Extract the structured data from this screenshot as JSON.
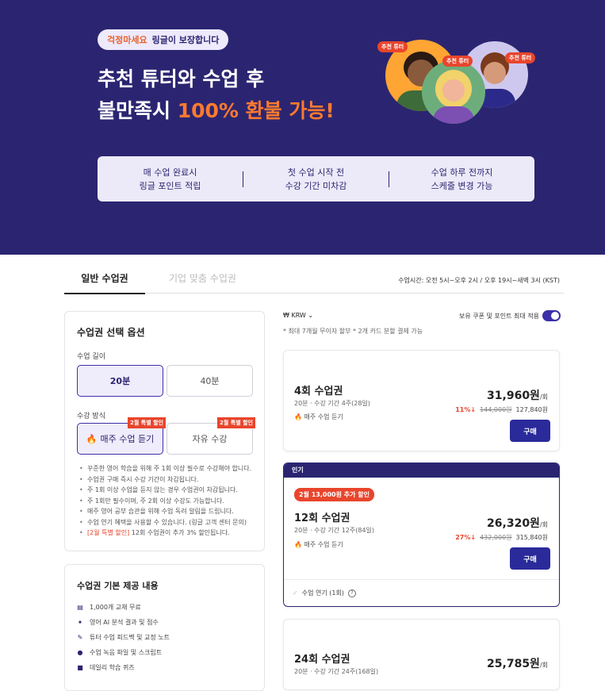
{
  "hero": {
    "pill_highlight": "걱정마세요",
    "pill_text": "링글이 보장합니다",
    "title_line1": "추천 튜터와 수업 후",
    "title_line2_a": "불만족시 ",
    "title_line2_b": "100% 환불 가능!",
    "tutor_tag": "추천 튜터",
    "benefits": [
      {
        "line1": "매 수업 완료시",
        "line2": "링글 포인트 적립"
      },
      {
        "line1": "첫 수업 시작 전",
        "line2": "수강 기간 미차감"
      },
      {
        "line1": "수업 하루 전까지",
        "line2": "스케줄 변경 가능"
      }
    ]
  },
  "tabs": {
    "active": "일반 수업권",
    "inactive": "기업 맞춤 수업권",
    "hours": "수업시간: 오전 5시~오후 2시 / 오후 19시~새벽 3시 (KST)"
  },
  "options": {
    "title": "수업권 선택 옵션",
    "length_label": "수업 길이",
    "len_20": "20분",
    "len_40": "40분",
    "mode_label": "수강 방식",
    "mode_weekly": "매주 수업 듣기",
    "mode_free": "자유 수강",
    "badge": "2월 특별 할인",
    "notes": [
      "꾸준한 영어 학습을 위해 주 1회 이상 필수로 수강해야 합니다.",
      "수업권 구매 즉시 수강 기간이 차감됩니다.",
      "주 1회 이상 수업을 듣지 않는 경우 수업권이 차감됩니다.",
      "주 1회만 필수이며, 주 2회 이상 수강도 가능합니다.",
      "매주 영어 공부 습관을 위해 수업 독려 알림을 드립니다.",
      "수업 연기 혜택을 사용할 수 있습니다. (링글 고객 센터 문의)"
    ],
    "note_last_red": "[2월 특별 할인]",
    "note_last_rest": " 12회 수업권이 추가 3% 할인됩니다."
  },
  "included": {
    "title": "수업권 기본 제공 내용",
    "items": [
      "1,000개 교재 무료",
      "영어 AI 분석 결과 및 점수",
      "튜터 수업 피드백 및 교정 노트",
      "수업 녹음 파일 및 스크립트",
      "데일리 학습 퀴즈"
    ]
  },
  "pricing": {
    "currency": "₩ KRW",
    "apply_label": "보유 쿠폰 및 포인트 최대 적용",
    "fine_print": "* 최대 7개월 무이자 할부  * 2개 카드 분할 결제 가능",
    "popular_label": "인기",
    "per_unit": "/회",
    "mode_tag": "매주 수업 듣기",
    "buy": "구매",
    "extend": "수업 연기 (1회)",
    "cards": [
      {
        "name": "4회 수업권",
        "sub": "20분 · 수강 기간 4주(28일)",
        "price": "31,960원",
        "pct": "11%↓",
        "orig": "144,000원",
        "total": "127,840원"
      },
      {
        "name": "12회 수업권",
        "sub": "20분 · 수강 기간 12주(84일)",
        "price": "26,320원",
        "pct": "27%↓",
        "orig": "432,000원",
        "total": "315,840원",
        "promo": "2월 13,000원 추가 할인"
      },
      {
        "name": "24회 수업권",
        "sub": "20분 · 수강 기간 24주(168일)",
        "price": "25,785원"
      }
    ]
  }
}
